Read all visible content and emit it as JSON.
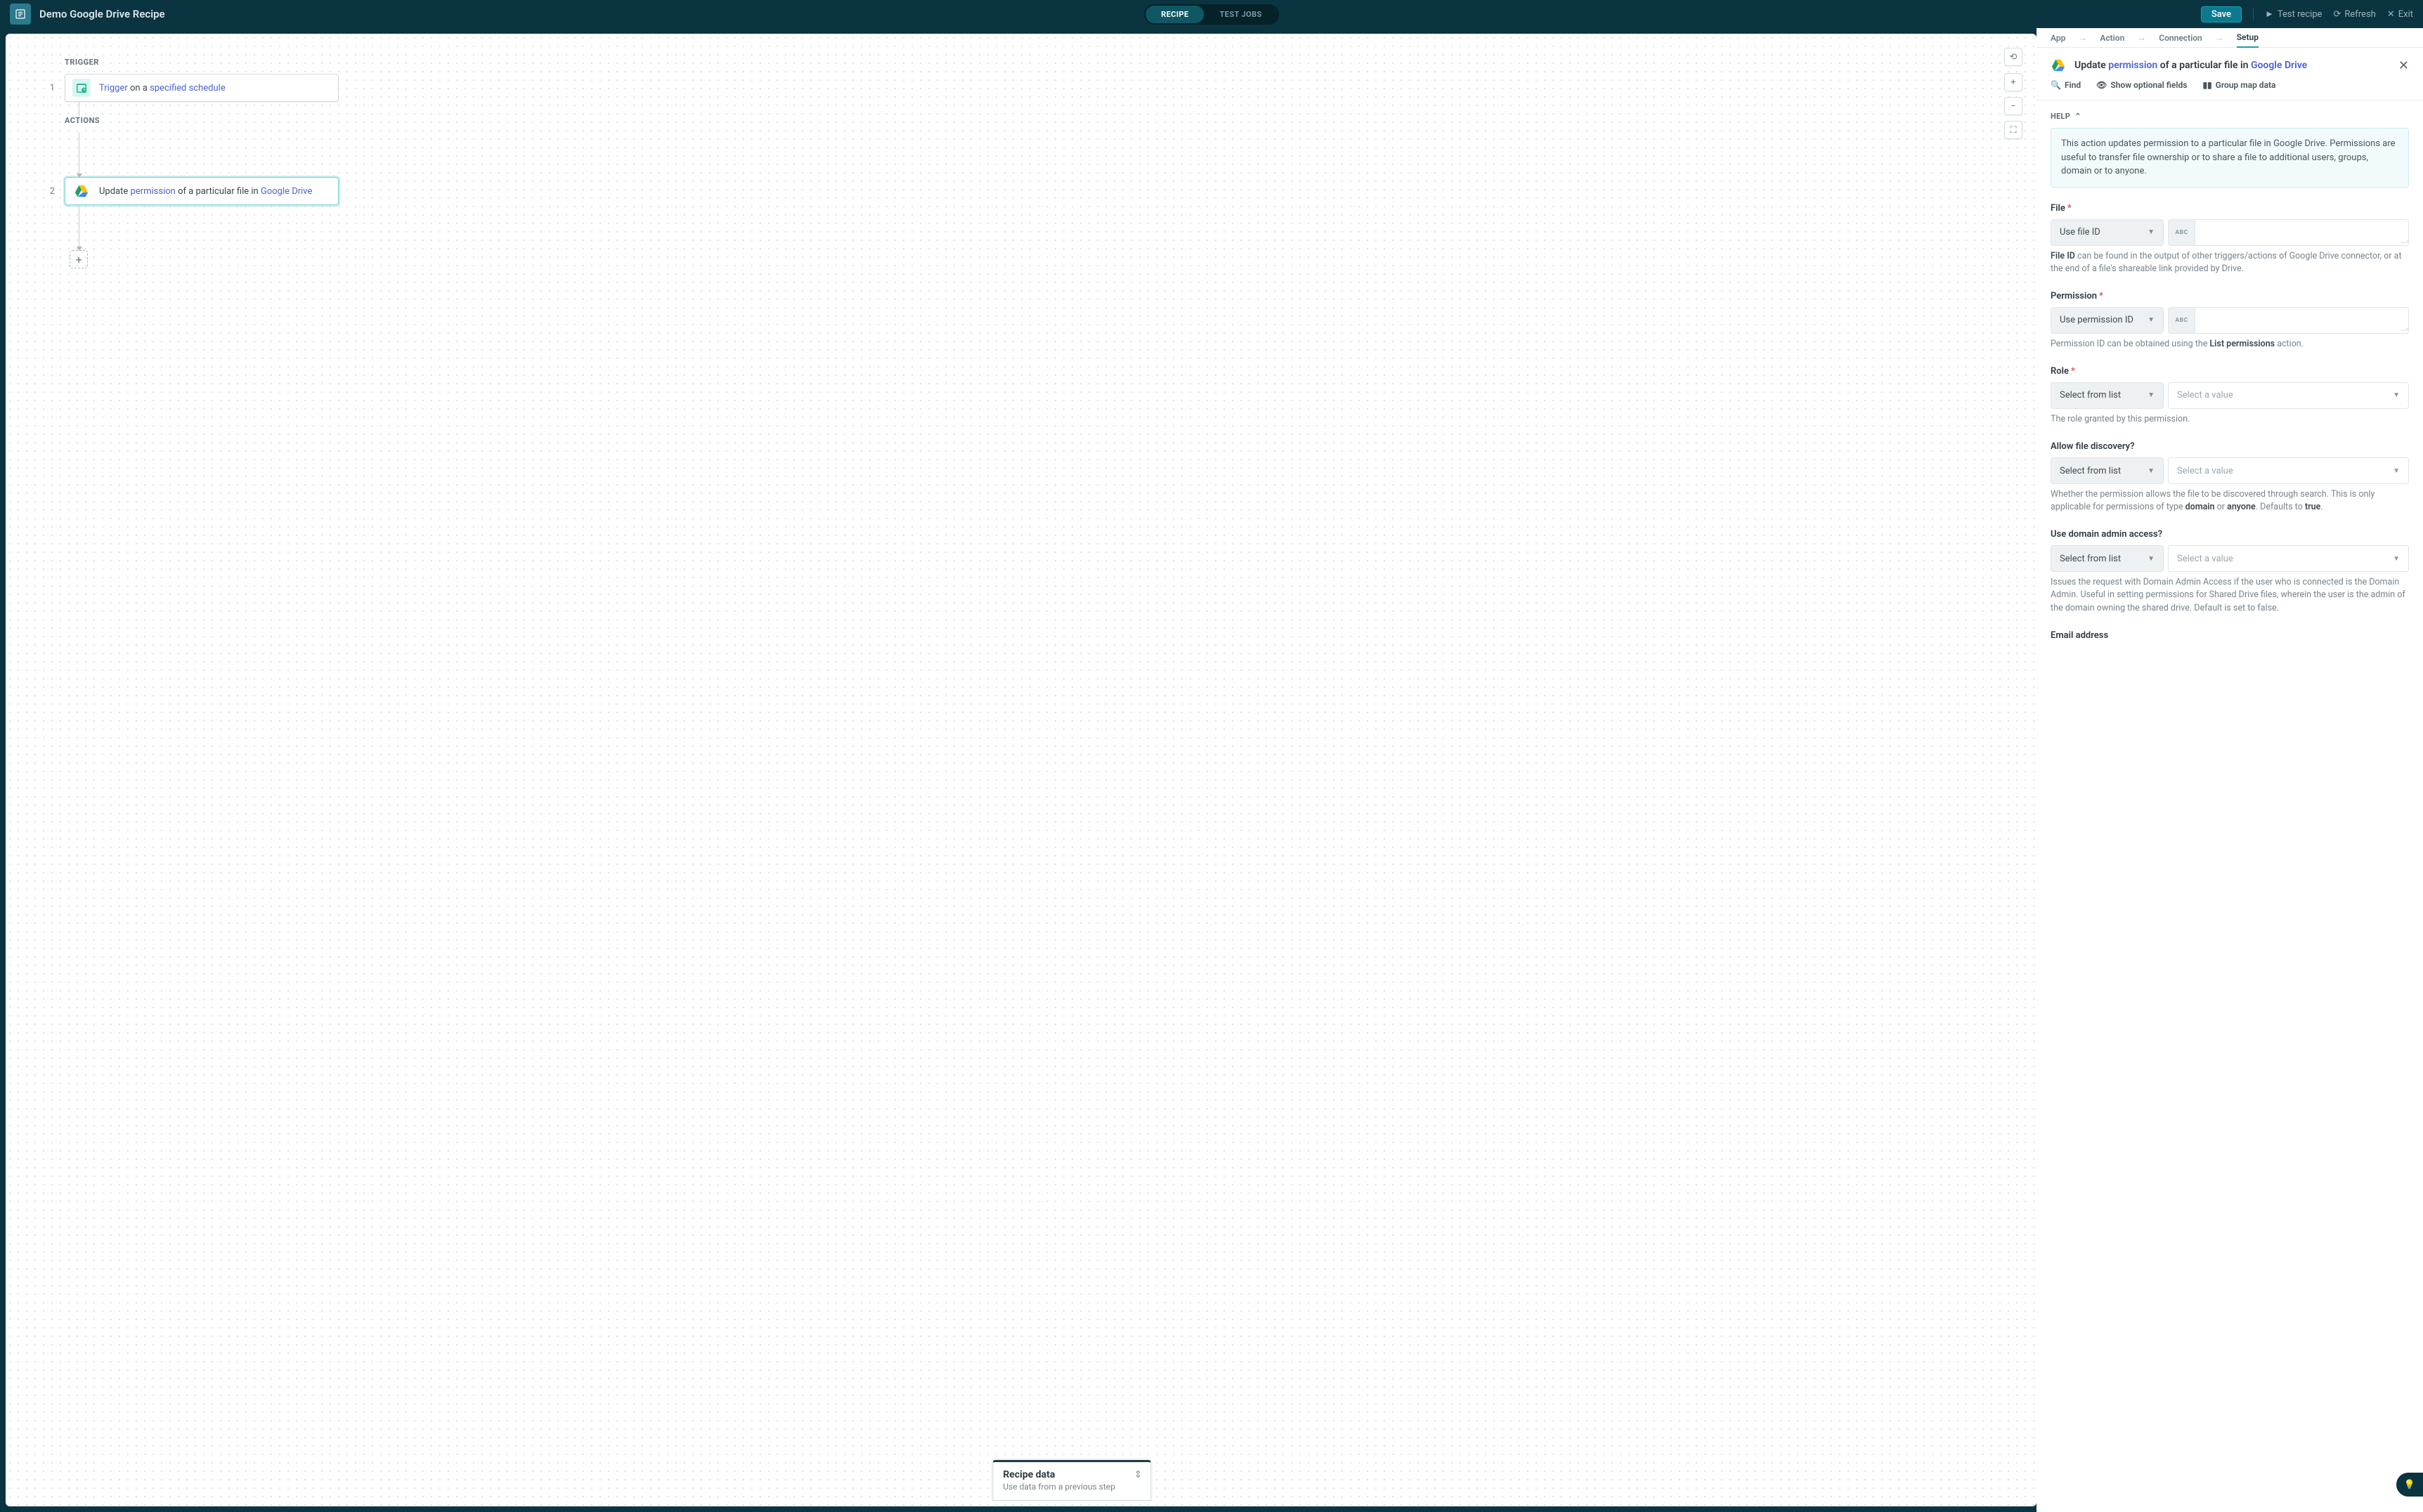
{
  "topbar": {
    "title": "Demo Google Drive Recipe",
    "tabs": {
      "recipe": "RECIPE",
      "test": "TEST JOBS"
    },
    "save": "Save",
    "menu": {
      "test_recipe": "Test recipe",
      "refresh": "Refresh",
      "exit": "Exit"
    }
  },
  "flow": {
    "trigger_label": "TRIGGER",
    "actions_label": "ACTIONS",
    "step1": {
      "num": "1",
      "prefix": "Trigger",
      "mid": " on a ",
      "link": "specified schedule"
    },
    "step2": {
      "num": "2",
      "prefix": "Update ",
      "hl": "permission",
      "mid": " of a particular file in ",
      "link": "Google Drive"
    }
  },
  "recipe_data": {
    "title": "Recipe data",
    "subtitle": "Use data from a previous step"
  },
  "panel": {
    "tabs": {
      "app": "App",
      "action": "Action",
      "connection": "Connection",
      "setup": "Setup"
    },
    "head": {
      "update": "Update ",
      "permission": "permission",
      "mid": " of a particular file in ",
      "gdrive": "Google Drive"
    },
    "tools": {
      "find": "Find",
      "optional": "Show optional fields",
      "group": "Group map data"
    },
    "help_label": "HELP",
    "help_text": "This action updates permission to a particular file in Google Drive. Permissions are useful to transfer file ownership or to share a file to additional users, groups, domain or to anyone.",
    "fields": {
      "file": {
        "label": "File",
        "sel": "Use file ID",
        "type": "ABC",
        "help_pre": "File ID",
        "help_rest": " can be found in the output of other triggers/actions of Google Drive connector, or at the end of a file's shareable link provided by Drive."
      },
      "permission": {
        "label": "Permission",
        "sel": "Use permission ID",
        "type": "ABC",
        "help_pre": "Permission ID can be obtained using the ",
        "help_bold": "List permissions",
        "help_post": " action."
      },
      "role": {
        "label": "Role",
        "sel": "Select from list",
        "placeholder": "Select a value",
        "help": "The role granted by this permission."
      },
      "discovery": {
        "label": "Allow file discovery?",
        "sel": "Select from list",
        "placeholder": "Select a value",
        "help_a": "Whether the permission allows the file to be discovered through search. This is only applicable for permissions of type ",
        "help_b": "domain",
        "help_c": " or ",
        "help_d": "anyone",
        "help_e": ". Defaults to ",
        "help_f": "true",
        "help_g": "."
      },
      "admin": {
        "label": "Use domain admin access?",
        "sel": "Select from list",
        "placeholder": "Select a value",
        "help": "Issues the request with Domain Admin Access if the user who is connected is the Domain Admin. Useful in setting permissions for Shared Drive files, wherein the user is the admin of the domain owning the shared drive. Default is set to false."
      },
      "email": {
        "label": "Email address"
      }
    }
  }
}
